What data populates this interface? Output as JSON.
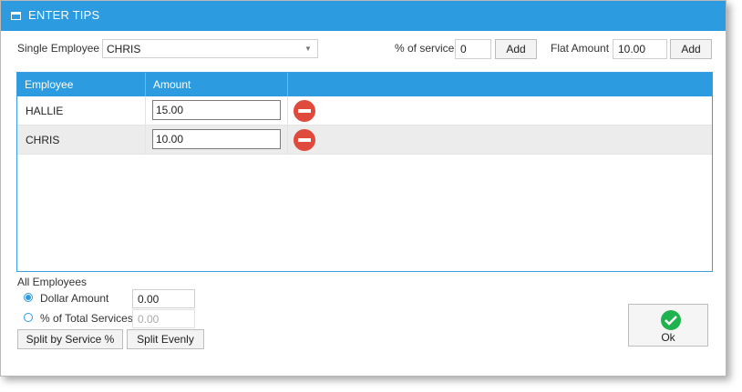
{
  "window": {
    "title": "ENTER TIPS"
  },
  "single_employee": {
    "label": "Single Employee",
    "selected": "CHRIS"
  },
  "percent_service": {
    "label": "% of service",
    "value": "0",
    "add_label": "Add"
  },
  "flat_amount": {
    "label": "Flat Amount",
    "value": "10.00",
    "add_label": "Add"
  },
  "grid": {
    "columns": [
      "Employee",
      "Amount"
    ],
    "rows": [
      {
        "employee": "HALLIE",
        "amount": "15.00"
      },
      {
        "employee": "CHRIS",
        "amount": "10.00"
      }
    ]
  },
  "all_employees": {
    "label": "All Employees",
    "dollar_amount": {
      "label": "Dollar Amount",
      "value": "0.00",
      "selected": true
    },
    "percent_total": {
      "label": "% of Total Services",
      "value": "0.00",
      "selected": false
    },
    "split_by_service_label": "Split by Service %",
    "split_evenly_label": "Split Evenly"
  },
  "ok_label": "Ok",
  "colors": {
    "accent": "#2d9be0",
    "remove": "#e04a3c",
    "ok": "#1fb24f"
  }
}
